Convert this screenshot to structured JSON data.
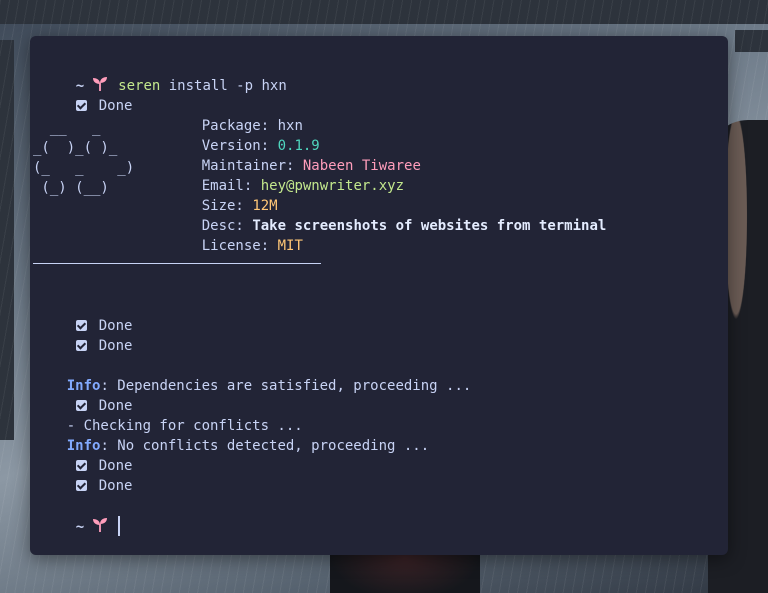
{
  "prompt": {
    "symbol": "~",
    "icon": "sprout-icon",
    "command_program": "seren",
    "command_args": "install -p hxn"
  },
  "done_label": "Done",
  "package_info": {
    "package_label": "Package:",
    "package_value": "hxn",
    "version_label": "Version:",
    "version_value": "0.1.9",
    "maintainer_label": "Maintainer:",
    "maintainer_value": "Nabeen Tiwaree",
    "email_label": "Email:",
    "email_value": "hey@pwnwriter.xyz",
    "size_label": "Size:",
    "size_value": "12M",
    "desc_label": "Desc:",
    "desc_value": "Take screenshots of websites from terminal",
    "license_label": "License:",
    "license_value": "MIT"
  },
  "ascii_logo": {
    "line1": "  __   _",
    "line2": "_(  )_( )_",
    "line3": "(_   _    _)",
    "line4": " (_) (__)"
  },
  "log": {
    "info_label": "Info",
    "deps_message": ": Dependencies are satisfied, proceeding ...",
    "checking_message": "- Checking for conflicts ...",
    "conflicts_message": ": No conflicts detected, proceeding ..."
  },
  "colors": {
    "terminal_bg": "#222436",
    "text": "#c8d3f5",
    "command": "#c3e88d",
    "version": "#4fd6be",
    "maintainer": "#ff9dbb",
    "email": "#c3e88d",
    "size_license": "#ffc777",
    "info": "#82aaff",
    "sprout": "#ff9dbb"
  }
}
